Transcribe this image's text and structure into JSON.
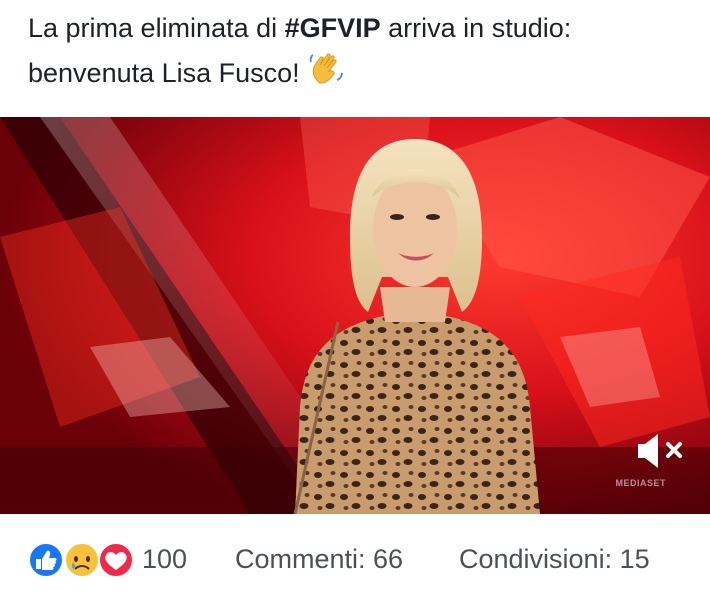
{
  "post": {
    "caption_prefix": "La prima eliminata di ",
    "hashtag": "#GFVIP",
    "caption_suffix": " arriva in studio: benvenuta Lisa Fusco! ",
    "emoji": "waving-hand"
  },
  "video": {
    "watermark": "MEDIASET",
    "muted": true,
    "mute_icon": "speaker-muted-icon"
  },
  "footer": {
    "reaction_icons": [
      "like-icon",
      "sad-icon",
      "love-icon"
    ],
    "reaction_count": "100",
    "comments_label": "Commenti: 66",
    "shares_label": "Condivisioni: 15"
  },
  "colors": {
    "like_blue": "#1877f2",
    "love_red": "#f0284a",
    "sad_yellow": "#f7c23a",
    "text_muted": "#4b4f56"
  }
}
